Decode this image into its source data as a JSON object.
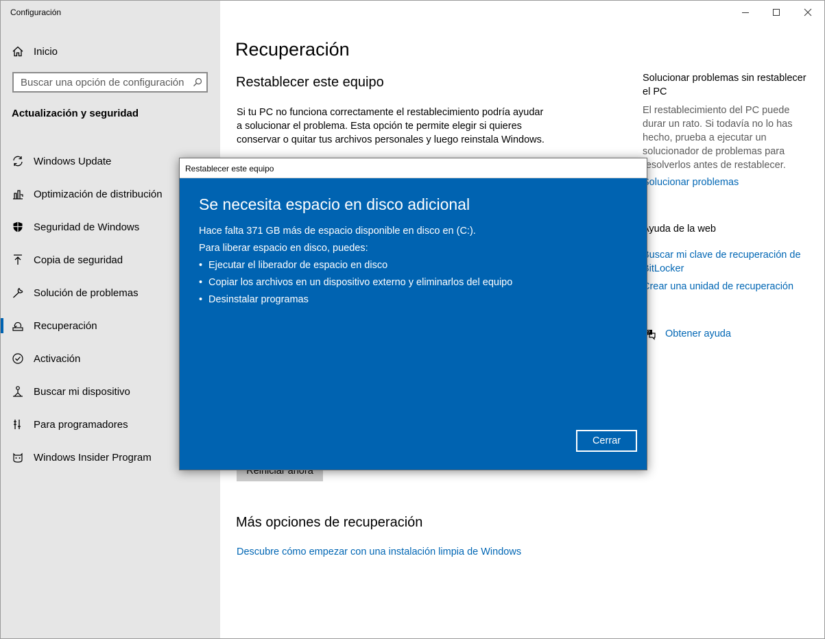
{
  "window": {
    "title": "Configuración"
  },
  "sidebar": {
    "home_label": "Inicio",
    "search_placeholder": "Buscar una opción de configuración",
    "section_title": "Actualización y seguridad",
    "items": [
      {
        "label": "Windows Update",
        "icon": "refresh-icon"
      },
      {
        "label": "Optimización de distribución",
        "icon": "delivery-icon"
      },
      {
        "label": "Seguridad de Windows",
        "icon": "shield-icon"
      },
      {
        "label": "Copia de seguridad",
        "icon": "backup-arrow-icon"
      },
      {
        "label": "Solución de problemas",
        "icon": "wrench-icon"
      },
      {
        "label": "Recuperación",
        "icon": "recovery-icon",
        "selected": true
      },
      {
        "label": "Activación",
        "icon": "check-circle-icon"
      },
      {
        "label": "Buscar mi dispositivo",
        "icon": "person-pin-icon"
      },
      {
        "label": "Para programadores",
        "icon": "dev-tools-icon"
      },
      {
        "label": "Windows Insider Program",
        "icon": "insider-cat-icon"
      }
    ]
  },
  "main": {
    "title": "Recuperación",
    "reset_heading": "Restablecer este equipo",
    "reset_text": "Si tu PC no funciona correctamente el restablecimiento podría ayudar a solucionar el problema. Esta opción te permite elegir si quieres conservar o quitar tus archivos personales y luego reinstala Windows.",
    "restart_button": "Reiniciar ahora",
    "more_heading": "Más opciones de recuperación",
    "clean_install_link": "Descubre cómo empezar con una instalación limpia de Windows"
  },
  "right_panel": {
    "troubleshoot_title": "Solucionar problemas sin restablecer el PC",
    "troubleshoot_text": "El restablecimiento del PC puede durar un rato. Si todavía no lo has hecho, prueba a ejecutar un solucionador de problemas para resolverlos antes de restablecer.",
    "troubleshoot_link": "Solucionar problemas",
    "web_help_title": "Ayuda de la web",
    "bitlocker_link": "Buscar mi clave de recuperación de BitLocker",
    "recovery_drive_link": "Crear una unidad de recuperación",
    "get_help_link": "Obtener ayuda"
  },
  "dialog": {
    "title": "Restablecer este equipo",
    "heading": "Se necesita espacio en disco adicional",
    "line1": "Hace falta 371 GB más de espacio disponible en disco en (C:).",
    "line2": "Para liberar espacio en disco, puedes:",
    "bullets": [
      "Ejecutar el liberador de espacio en disco",
      "Copiar los archivos en un dispositivo externo y eliminarlos del equipo",
      "Desinstalar programas"
    ],
    "close_button": "Cerrar"
  },
  "colors": {
    "accent": "#0063b1",
    "link": "#0066b4",
    "sidebar_bg": "#e6e6e6"
  }
}
